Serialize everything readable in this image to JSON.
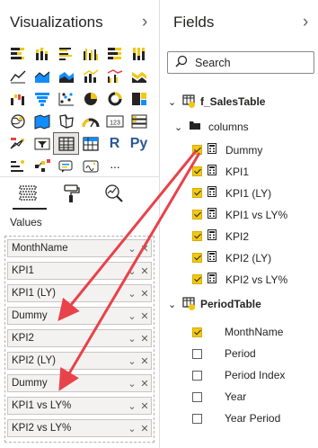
{
  "visualizations": {
    "title": "Visualizations",
    "collapse_icon": "chevron-right-icon"
  },
  "viz_tabs": [
    "fields-well-icon",
    "format-paint-roller-icon",
    "analytics-magnifier-icon"
  ],
  "values_label": "Values",
  "values_wells": [
    {
      "label": "MonthName"
    },
    {
      "label": "KPI1"
    },
    {
      "label": "KPI1 (LY)"
    },
    {
      "label": "Dummy"
    },
    {
      "label": "KPI2"
    },
    {
      "label": "KPI2 (LY)"
    },
    {
      "label": "Dummy"
    },
    {
      "label": "KPI1 vs LY%"
    },
    {
      "label": "KPI2 vs LY%"
    }
  ],
  "fields": {
    "title": "Fields",
    "collapse_icon": "chevron-right-icon",
    "search_placeholder": "Search",
    "tables": [
      {
        "name": "f_SalesTable",
        "folder": "columns",
        "items": [
          {
            "label": "Dummy",
            "checked": true
          },
          {
            "label": "KPI1",
            "checked": true
          },
          {
            "label": "KPI1 (LY)",
            "checked": true
          },
          {
            "label": "KPI1 vs LY%",
            "checked": true
          },
          {
            "label": "KPI2",
            "checked": true
          },
          {
            "label": "KPI2 (LY)",
            "checked": true
          },
          {
            "label": "KPI2 vs LY%",
            "checked": true
          }
        ]
      },
      {
        "name": "PeriodTable",
        "items": [
          {
            "label": "MonthName",
            "checked": true
          },
          {
            "label": "Period",
            "checked": false
          },
          {
            "label": "Period Index",
            "checked": false
          },
          {
            "label": "Year",
            "checked": false
          },
          {
            "label": "Year Period",
            "checked": false
          }
        ]
      }
    ]
  },
  "grid_icons": [
    [
      "stacked-bar-chart-icon",
      "stacked-column-chart-icon",
      "clustered-bar-chart-icon",
      "clustered-column-chart-icon",
      "100pct-stacked-bar-icon",
      "100pct-stacked-column-icon"
    ],
    [
      "line-chart-icon",
      "area-chart-icon",
      "stacked-area-chart-icon",
      "line-and-column-chart-icon",
      "line-and-clustered-column-icon",
      "ribbon-chart-icon"
    ],
    [
      "waterfall-chart-icon",
      "funnel-chart-icon",
      "scatter-chart-icon",
      "pie-chart-icon",
      "donut-chart-icon",
      "treemap-icon"
    ],
    [
      "map-icon",
      "filled-map-icon",
      "shape-map-icon",
      "gauge-icon",
      "card-icon",
      "multi-row-card-icon"
    ],
    [
      "kpi-icon",
      "slicer-icon",
      "table-icon",
      "matrix-icon",
      "r-script-visual-icon",
      "python-visual-icon"
    ],
    [
      "key-influencers-icon",
      "decomposition-tree-icon",
      "qa-visual-icon",
      "smart-narrative-icon",
      "more-visuals-icon"
    ]
  ],
  "grid_text": {
    "card": "123",
    "r": "R",
    "py": "Py",
    "more": "···"
  },
  "colors": {
    "accent": "#f2c811",
    "arrow": "#e8424a",
    "chart_blue": "#2b5797",
    "chart_yellow": "#f2c811",
    "chart_red": "#e8424a",
    "chart_teal": "#118dff"
  }
}
